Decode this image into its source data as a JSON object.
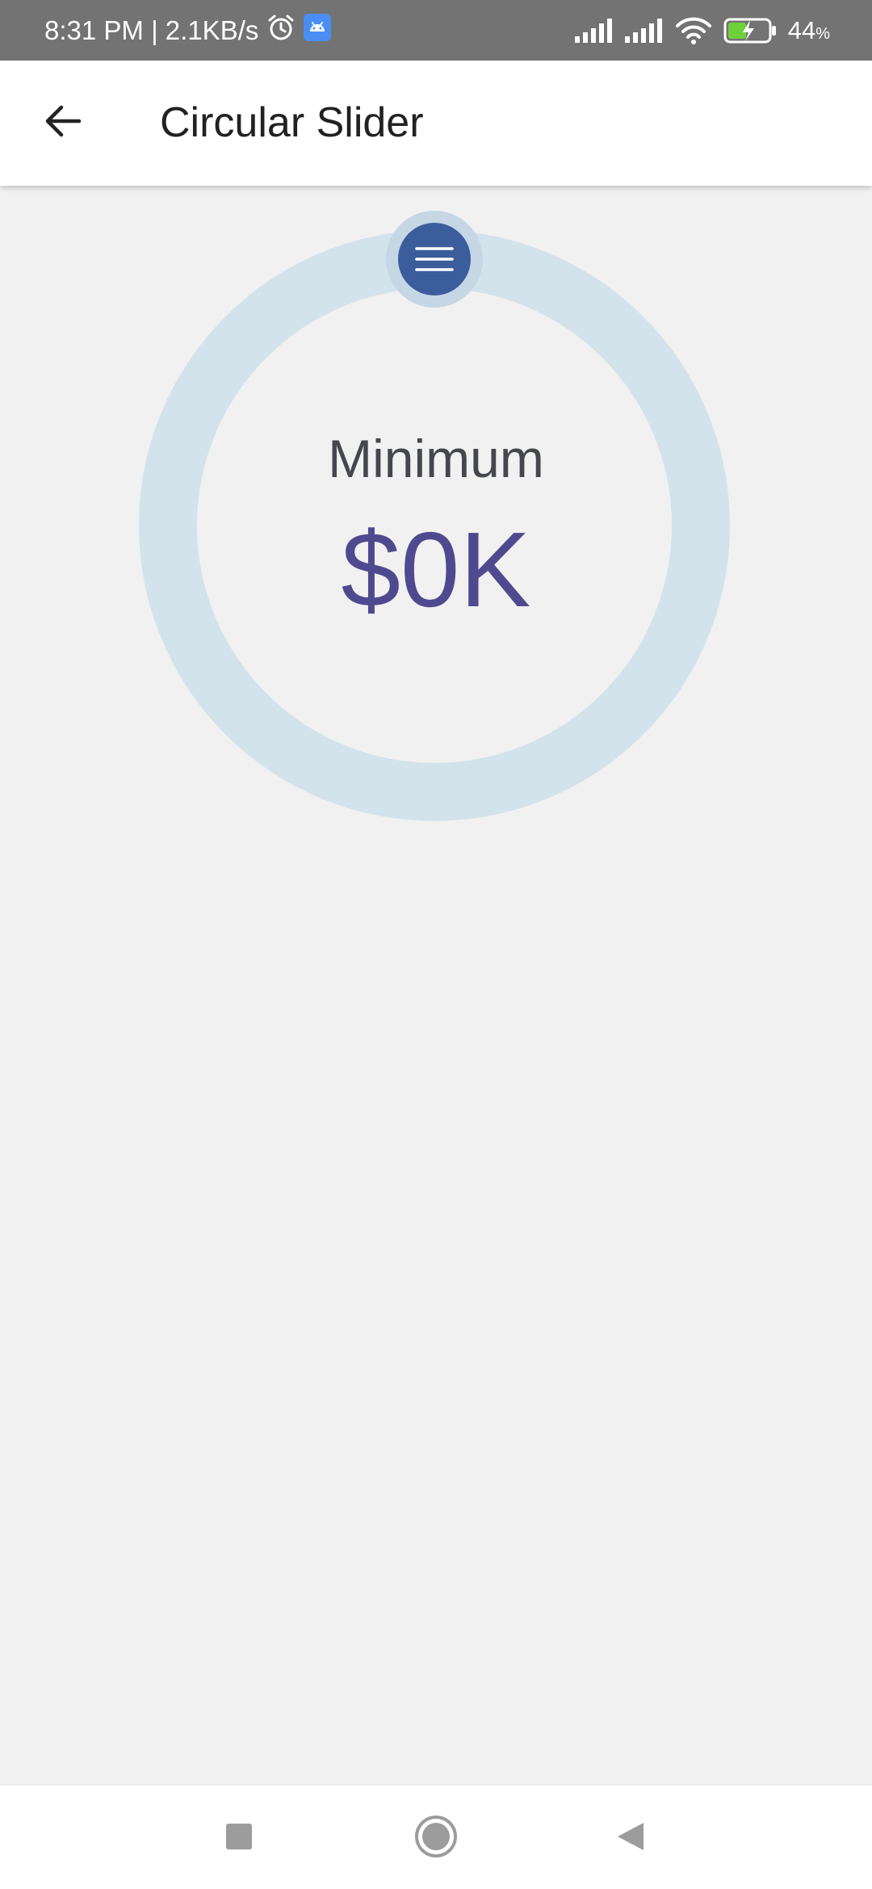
{
  "status_bar": {
    "time_speed": "8:31 PM | 2.1KB/s",
    "battery_percent": "44",
    "battery_unit": "%",
    "icons": [
      "alarm-icon",
      "android-app-icon",
      "signal-icon",
      "signal-icon",
      "wifi-icon",
      "battery-charging-icon"
    ]
  },
  "app_bar": {
    "title": "Circular Slider",
    "back_icon": "arrow-left-icon"
  },
  "slider": {
    "label": "Minimum",
    "value": "$0K",
    "progress_fraction": 0,
    "track_color": "#d3e3eb",
    "thumb_color": "#3c5d9b",
    "value_color": "#4f4a8f",
    "thumb_icon": "menu-lines-icon"
  },
  "nav_bar": {
    "icons": [
      "recent-apps-icon",
      "home-icon",
      "back-icon"
    ]
  }
}
